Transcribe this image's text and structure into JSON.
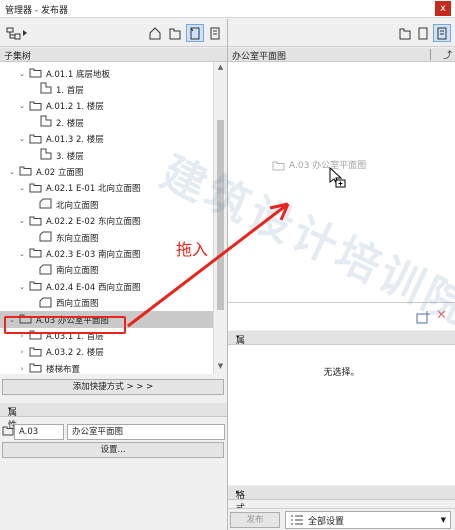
{
  "window": {
    "title": "管理器 - 发布器",
    "close": "x"
  },
  "left": {
    "tree_header": "子集树",
    "add_shortcut": "添加快捷方式 > > >",
    "props_header": "属性",
    "id_value": "A.03",
    "name_value": "办公室平面图",
    "settings_button": "设置..."
  },
  "tree_rows": [
    {
      "label": "A.01.1 底层地板",
      "type": "folder",
      "indent": 18,
      "twisty": "v"
    },
    {
      "label": "1. 首层",
      "type": "view",
      "indent": 28,
      "twisty": ""
    },
    {
      "label": "A.01.2 1. 楼层",
      "type": "folder",
      "indent": 18,
      "twisty": "v"
    },
    {
      "label": "2. 楼层",
      "type": "view",
      "indent": 28,
      "twisty": ""
    },
    {
      "label": "A.01.3 2. 楼层",
      "type": "folder",
      "indent": 18,
      "twisty": "v"
    },
    {
      "label": "3. 楼层",
      "type": "view",
      "indent": 28,
      "twisty": ""
    },
    {
      "label": "A.02 立面图",
      "type": "folder",
      "indent": 8,
      "twisty": "v"
    },
    {
      "label": "A.02.1 E-01 北向立面图",
      "type": "folder",
      "indent": 18,
      "twisty": "v"
    },
    {
      "label": "北向立面图",
      "type": "elev",
      "indent": 28,
      "twisty": ""
    },
    {
      "label": "A.02.2 E-02 东向立面图",
      "type": "folder",
      "indent": 18,
      "twisty": "v"
    },
    {
      "label": "东向立面图",
      "type": "elev",
      "indent": 28,
      "twisty": ""
    },
    {
      "label": "A.02.3 E-03 南向立面图",
      "type": "folder",
      "indent": 18,
      "twisty": "v"
    },
    {
      "label": "南向立面图",
      "type": "elev",
      "indent": 28,
      "twisty": ""
    },
    {
      "label": "A.02.4 E-04 西向立面图",
      "type": "folder",
      "indent": 18,
      "twisty": "v"
    },
    {
      "label": "西向立面图",
      "type": "elev",
      "indent": 28,
      "twisty": ""
    },
    {
      "label": "A.03 办公室平面图",
      "type": "folder",
      "indent": 8,
      "twisty": "v",
      "selected": true
    },
    {
      "label": "A.03.1 1. 首层",
      "type": "folder",
      "indent": 18,
      "twisty": ">"
    },
    {
      "label": "A.03.2 2. 楼层",
      "type": "folder",
      "indent": 18,
      "twisty": ">"
    },
    {
      "label": "楼梯布置",
      "type": "folder",
      "indent": 18,
      "twisty": ">"
    }
  ],
  "right": {
    "header": "办公室平面图",
    "drag_item": "A.03 办公室平面图",
    "props_header": "属性",
    "no_selection": "无选择。",
    "format_header": "格式",
    "publish_button": "发布",
    "set_dropdown": "全部设置"
  },
  "annotation": {
    "text": "拖入",
    "color": "#e8241c"
  },
  "watermark_text": "建筑设计培训院"
}
